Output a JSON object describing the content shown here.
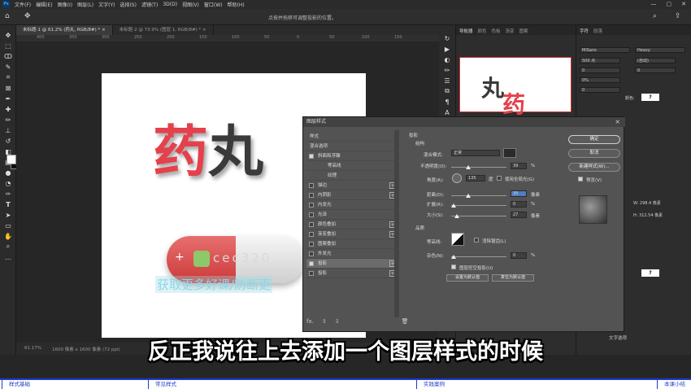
{
  "menubar": {
    "logo": "Ps",
    "items": [
      "文件(F)",
      "编辑(E)",
      "图像(I)",
      "图层(L)",
      "文字(Y)",
      "选择(S)",
      "滤镜(T)",
      "3D(D)",
      "视图(V)",
      "窗口(W)",
      "帮助(H)"
    ]
  },
  "optbar": {
    "hint": "点按并拖移可调整投影的位置。"
  },
  "tabs": [
    {
      "label": "未标题-1 @ 61.2% (药丸, RGB/8#) *",
      "close": "×"
    },
    {
      "label": "未标题-2 @ 73.9% (图层 1, RGB/8#) *",
      "close": "×"
    }
  ],
  "ruler": [
    "400",
    "350",
    "300",
    "250",
    "200",
    "150",
    "100",
    "50",
    "0",
    "50",
    "100",
    "150"
  ],
  "status": {
    "zoom": "61.17%",
    "docinfo": "1600 像素 x 1600 像素 (72 ppi)"
  },
  "artwork": {
    "char1": "药",
    "char2": "丸",
    "pill_plus": "+",
    "pill_id": "cec320",
    "watermark": "获取更多好课/防断更"
  },
  "right_tabs_left": [
    "导航器",
    "颜色",
    "色板",
    "渐变",
    "图案"
  ],
  "right_tabs_right": [
    "字符",
    "段落"
  ],
  "navigator": {
    "char1": "药",
    "char2": "丸"
  },
  "character": {
    "font": "MiSans",
    "style": "Heavy",
    "size": "500 点",
    "leading": "(自动)",
    "va": "0",
    "scale": "0%",
    "tracking": "0",
    "color_label": "颜色:",
    "q": "?",
    "w_label": "W: 298.4 像素",
    "h_label": "H: 312.54 像素",
    "text_options": "文字选项"
  },
  "dialog": {
    "title": "图层样式",
    "close": "×",
    "list": [
      {
        "label": "样式",
        "check": false,
        "plus": false,
        "noBox": true
      },
      {
        "label": "混合选项",
        "check": false,
        "plus": false,
        "noBox": true
      },
      {
        "label": "斜面和浮雕",
        "check": true,
        "plus": false
      },
      {
        "label": "等高线",
        "check": false,
        "plus": false,
        "indent": true
      },
      {
        "label": "纹理",
        "check": false,
        "plus": false,
        "indent": true
      },
      {
        "label": "描边",
        "check": false,
        "plus": true
      },
      {
        "label": "内阴影",
        "check": false,
        "plus": true
      },
      {
        "label": "内发光",
        "check": false,
        "plus": false
      },
      {
        "label": "光泽",
        "check": false,
        "plus": false
      },
      {
        "label": "颜色叠加",
        "check": false,
        "plus": true
      },
      {
        "label": "渐变叠加",
        "check": false,
        "plus": true
      },
      {
        "label": "图案叠加",
        "check": false,
        "plus": false
      },
      {
        "label": "外发光",
        "check": false,
        "plus": false
      },
      {
        "label": "投影",
        "check": true,
        "plus": true,
        "selected": true
      },
      {
        "label": "投影",
        "check": false,
        "plus": true
      }
    ],
    "bottom_icons": [
      "fx.",
      "⇧",
      "⇩",
      "🗑"
    ],
    "section": "投影",
    "structure": "结构",
    "blend_mode_label": "混合模式:",
    "blend_mode_value": "正常",
    "opacity_label": "不透明度(O):",
    "opacity_value": "39",
    "angle_label": "角度(A):",
    "angle_value": "135",
    "angle_unit": "度",
    "global_light": "使用全局光(G)",
    "distance_label": "距离(D):",
    "distance_value": "35",
    "spread_label": "扩展(R):",
    "spread_value": "0",
    "size_label": "大小(S):",
    "size_value": "27",
    "unit_px": "像素",
    "unit_pct": "%",
    "quality": "品质",
    "contour_label": "等高线:",
    "antialias": "消除锯齿(L)",
    "noise_label": "杂色(N):",
    "noise_value": "0",
    "knockout": "图层挖空投影(U)",
    "set_default": "设置为默认值",
    "reset_default": "复位为默认值",
    "ok": "确定",
    "cancel": "取消",
    "new_style": "新建样式(W)...",
    "preview": "预览(V)"
  },
  "subtitle": "反正我说往上去添加一个图层样式的时候",
  "chapters": [
    "样式基础",
    "常见样式",
    "实践案例",
    "本课小结"
  ],
  "colors": {
    "accent_red": "#e4414c",
    "chapter_blue": "#1a3cc9"
  }
}
